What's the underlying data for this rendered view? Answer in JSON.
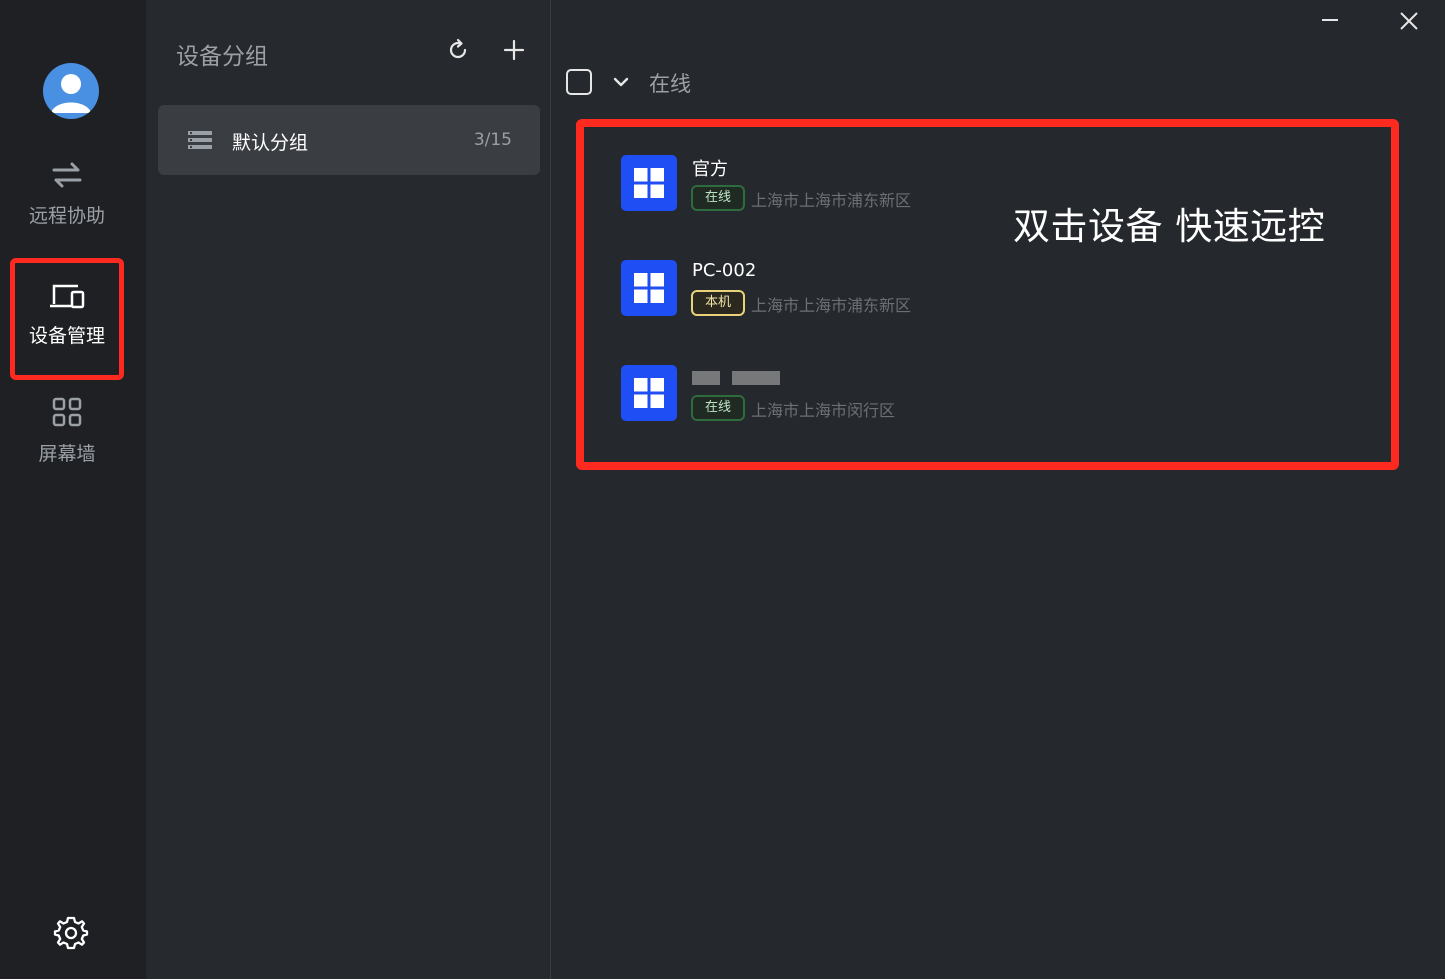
{
  "nav": {
    "items": [
      {
        "label": "远程协助",
        "icon": "swap-arrows-icon"
      },
      {
        "label": "设备管理",
        "icon": "devices-icon",
        "active": true
      },
      {
        "label": "屏幕墙",
        "icon": "grid-icon"
      }
    ],
    "settings_icon": "gear-icon"
  },
  "groups": {
    "title": "设备分组",
    "items": [
      {
        "name": "默认分组",
        "count": "3/15"
      }
    ]
  },
  "main": {
    "filter_label": "在线",
    "hint": "双击设备 快速远控",
    "devices": [
      {
        "name": "官方",
        "status": "在线",
        "location": "上海市上海市浦东新区"
      },
      {
        "name": "PC-002",
        "status": "本机",
        "location": "上海市上海市浦东新区"
      },
      {
        "name": "",
        "status": "在线",
        "location": "上海市上海市闵行区"
      }
    ]
  },
  "colors": {
    "accent_blue": "#1f4ef5",
    "highlight_red": "#ff2a1f",
    "online_green": "#2e6b3e",
    "local_yellow": "#e8d27a"
  }
}
